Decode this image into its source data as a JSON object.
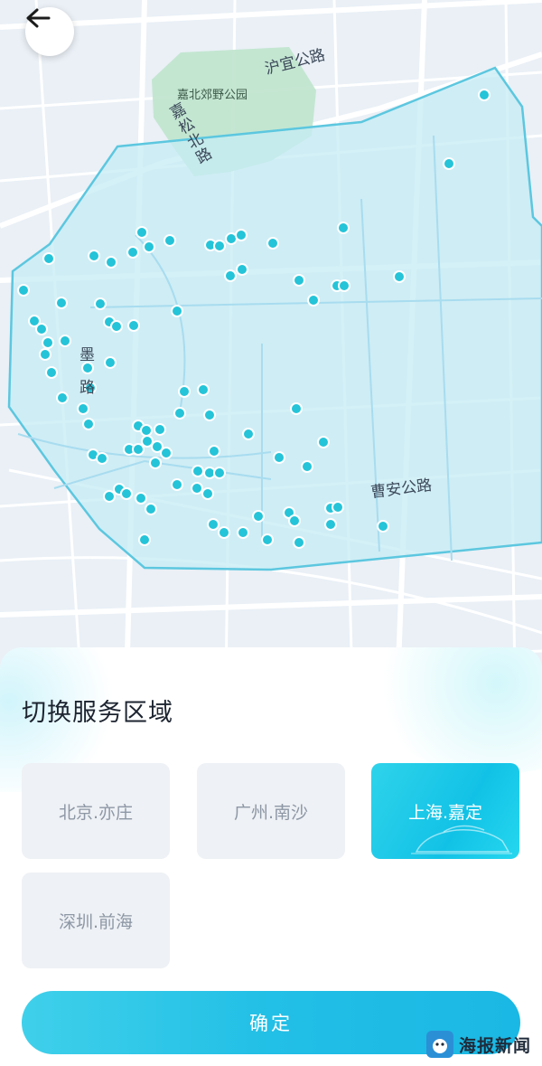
{
  "map": {
    "labels": {
      "road_huyi": "沪宜公路",
      "road_caoan": "曹安公路",
      "road_jiasongbei": "嘉松北路",
      "park": "嘉北郊野公园",
      "fragment_mo": "墨",
      "fragment_lu": "路"
    },
    "colors": {
      "service_area_fill": "#c6ecf4",
      "service_area_border": "#5cc7df",
      "park": "#bfe4cd",
      "point": "#25c4d8",
      "roads": "#ffffff",
      "rivers": "#a8dcef"
    },
    "back_icon": "arrow-left-icon"
  },
  "panel": {
    "title": "切换服务区域",
    "regions": [
      {
        "label": "北京.亦庄",
        "selected": false
      },
      {
        "label": "广州.南沙",
        "selected": false
      },
      {
        "label": "上海.嘉定",
        "selected": true
      },
      {
        "label": "深圳.前海",
        "selected": false
      }
    ],
    "confirm_label": "确定"
  },
  "watermark": {
    "text": "海报新闻"
  }
}
